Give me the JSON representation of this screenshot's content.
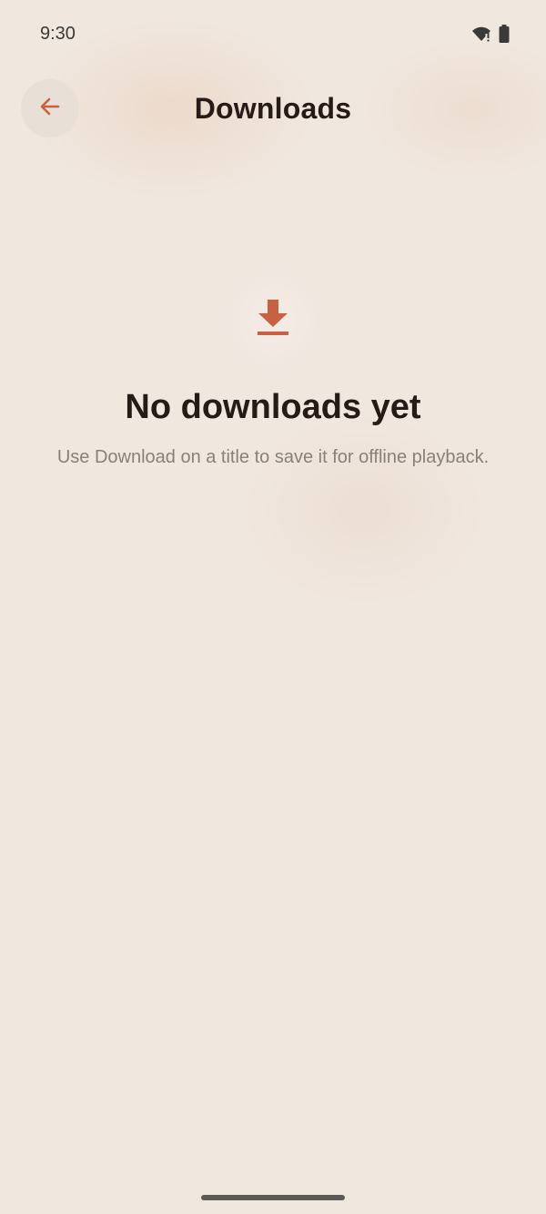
{
  "status_bar": {
    "time": "9:30",
    "icons": [
      "wifi-icon",
      "battery-icon"
    ]
  },
  "top_bar": {
    "title": "Downloads",
    "back_icon": "arrow-back-icon"
  },
  "empty_state": {
    "icon": "download-icon",
    "title": "No downloads yet",
    "subtitle": "Use Download on a title to save it for offline playback."
  },
  "colors": {
    "background": "#f0e7df",
    "accent": "#c8613f",
    "title_text": "#261b16",
    "secondary_text": "#8a807a"
  }
}
